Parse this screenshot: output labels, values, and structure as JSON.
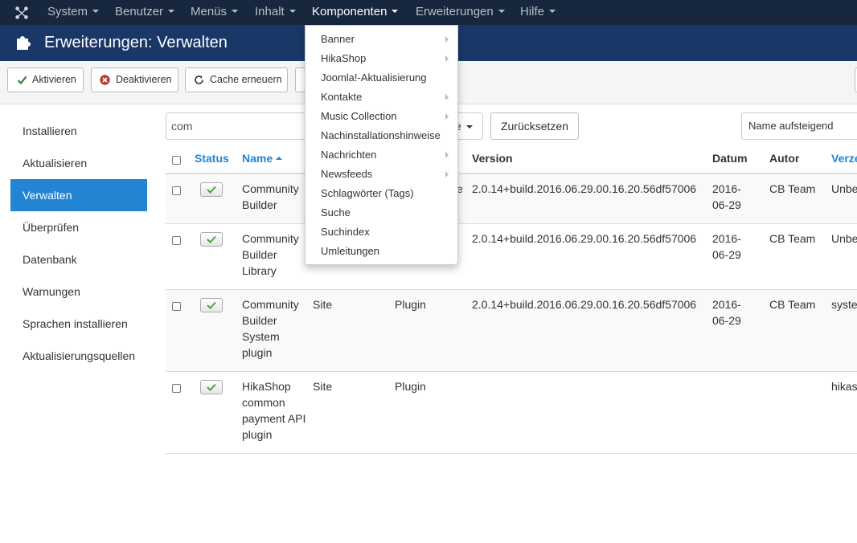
{
  "navbar": {
    "logo": "joomla-logo-icon",
    "items": [
      {
        "label": "System"
      },
      {
        "label": "Benutzer"
      },
      {
        "label": "Menüs"
      },
      {
        "label": "Inhalt"
      },
      {
        "label": "Komponenten"
      },
      {
        "label": "Erweiterungen"
      },
      {
        "label": "Hilfe"
      }
    ]
  },
  "header": {
    "title": "Erweiterungen: Verwalten",
    "icon": "puzzle-icon"
  },
  "toolbar": {
    "buttons": [
      {
        "label": "Aktivieren",
        "icon": "check-icon"
      },
      {
        "label": "Deaktivieren",
        "icon": "times-circle-icon"
      },
      {
        "label": "Cache erneuern",
        "icon": "refresh-icon"
      }
    ]
  },
  "sidebar": {
    "items": [
      {
        "label": "Installieren"
      },
      {
        "label": "Aktualisieren"
      },
      {
        "label": "Verwalten"
      },
      {
        "label": "Überprüfen"
      },
      {
        "label": "Datenbank"
      },
      {
        "label": "Warnungen"
      },
      {
        "label": "Sprachen installieren"
      },
      {
        "label": "Aktualisierungsquellen"
      }
    ]
  },
  "filters": {
    "search_value": "com",
    "select_label": "e",
    "reset_label": "Zurücksetzen",
    "sort_label": "Name aufsteigend"
  },
  "table": {
    "headers": {
      "status": "Status",
      "name": "Name",
      "version": "Version",
      "date": "Datum",
      "author": "Autor",
      "folder": "Verze"
    },
    "rows": [
      {
        "name": "Community Builder",
        "location": "",
        "type": "e",
        "version": "2.0.14+build.2016.06.29.00.16.20.56df57006",
        "date": "2016-06-29",
        "author": "CB Team",
        "folder": "Unbe"
      },
      {
        "name": "Community Builder Library",
        "location": "",
        "type": "",
        "version": "2.0.14+build.2016.06.29.00.16.20.56df57006",
        "date": "2016-06-29",
        "author": "CB Team",
        "folder": "Unbe"
      },
      {
        "name": "Community Builder System plugin",
        "location": "Site",
        "type": "Plugin",
        "version": "2.0.14+build.2016.06.29.00.16.20.56df57006",
        "date": "2016-06-29",
        "author": "CB Team",
        "folder": "syste"
      },
      {
        "name": "HikaShop common payment API plugin",
        "location": "Site",
        "type": "Plugin",
        "version": "",
        "date": "",
        "author": "",
        "folder": "hikas"
      }
    ]
  },
  "dropdown": {
    "items": [
      {
        "label": "Banner",
        "submenu": true
      },
      {
        "label": "HikaShop",
        "submenu": true
      },
      {
        "label": "Joomla!-Aktualisierung",
        "submenu": false
      },
      {
        "label": "Kontakte",
        "submenu": true
      },
      {
        "label": "Music Collection",
        "submenu": true
      },
      {
        "label": "Nachinstallationshinweise",
        "submenu": false
      },
      {
        "label": "Nachrichten",
        "submenu": true
      },
      {
        "label": "Newsfeeds",
        "submenu": true
      },
      {
        "label": "Schlagwörter (Tags)",
        "submenu": false
      },
      {
        "label": "Suche",
        "submenu": false
      },
      {
        "label": "Suchindex",
        "submenu": false
      },
      {
        "label": "Umleitungen",
        "submenu": false
      }
    ]
  },
  "colors": {
    "navbar": "#17273d",
    "header": "#1a3867",
    "accent": "#2384d3"
  }
}
